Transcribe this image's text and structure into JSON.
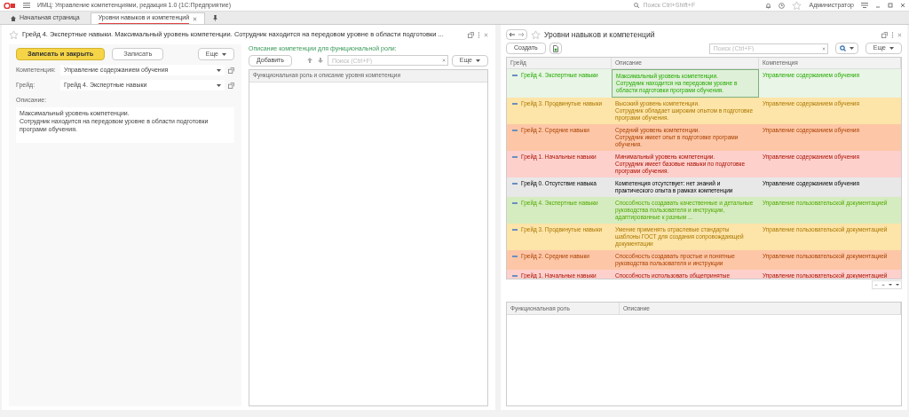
{
  "app_bar": {
    "title": "ИМЦ: Управление компетенциями, редакция 1.0  (1С:Предприятие)",
    "search": {
      "placeholder": "Поиск Ctrl+Shift+F"
    },
    "user": "Администратор"
  },
  "tabs": [
    {
      "label": "Начальная страница",
      "selected": false,
      "kind": "home"
    },
    {
      "label": "Уровни навыков и компетенций",
      "selected": true,
      "kind": "page"
    }
  ],
  "form": {
    "title": "Грейд 4. Экспертные навыки. Максимальный уровень компетенции. Сотрудник находится на передовом уровне в области подготовки ...",
    "buttons": [
      {
        "label": "Записать и закрыть",
        "kind": "primary"
      },
      {
        "label": "Записать",
        "kind": "plain"
      }
    ],
    "more": "Еще",
    "fields": [
      {
        "label": "Компетенция:",
        "value": "Управление содержанием обучения"
      },
      {
        "label": "Грейд:",
        "value": "Грейд 4. Экспертные навыки"
      }
    ],
    "description": {
      "label": "Описание:",
      "value": "Максимальный уровень компетенции.\nСотрудник находится на передовом уровне в области подготовки програми обучения."
    },
    "roles": {
      "title": "Описание компетенции для функциональной роли:",
      "add": "Добавить",
      "search": {
        "placeholder": "Поиск (Ctrl+F)"
      },
      "more": "Еще",
      "column": "Функциональная роль и описание уровня компетенции"
    }
  },
  "list": {
    "title": "Уровни навыков и компетенций",
    "create": "Создать",
    "search": {
      "placeholder": "Поиск (Ctrl+F)"
    },
    "more": "Еще",
    "columns": [
      "Грейд",
      "Описание",
      "Компетенция"
    ],
    "rows": [
      {
        "grade": "Грейд 4. Экспертные навыки",
        "description": "Максимальный уровень компетенции.\nСотрудник находится на передовом уровне в области подготовки програми обучения.",
        "competence": "Управление содержанием обучения",
        "color": "#e9f5e6",
        "selected": true
      },
      {
        "grade": "Грейд 3. Продвинутые навыки",
        "description": "Высокий уровень компетенции.\nСотрудник обладает широким опытом в подготовке програми обучения.",
        "competence": "Управление содержанием обучения",
        "color": "#fde4a8",
        "selected": false
      },
      {
        "grade": "Грейд 2. Средние навыки",
        "description": "Средний уровень компетенции.\nСотрудник имеет опыт в подготовке програми обучения.",
        "competence": "Управление содержанием обучения",
        "color": "#fdc7a7",
        "selected": false
      },
      {
        "grade": "Грейд 1. Начальные навыки",
        "description": "Минимальный уровень компетенции.\nСотрудник имеет базовые навыки по подготовке програми обучения.",
        "competence": "Управление содержанием обучения",
        "color": "#fdd0cc",
        "selected": false
      },
      {
        "grade": "Грейд 0. Отсутствие навыка",
        "description": "Компетенция отсутствует: нет знаний и практического опыта в рамках компетенции",
        "competence": "Управление содержанием обучения",
        "color": "#e8e8e8",
        "selected": false
      },
      {
        "grade": "Грейд 4. Экспертные навыки",
        "description": "Способность создавать качественные и детальные руководства пользователя и инструкции, адаптированные к разным ...",
        "competence": "Управление пользовательской документацией",
        "color": "#d5ecc0",
        "selected": false
      },
      {
        "grade": "Грейд 3. Продвинутые навыки",
        "description": "Умение применять отраслевые стандарты шаблоны ГОСТ для создания сопровождающей документации",
        "competence": "Управление пользовательской документацией",
        "color": "#fde4a8",
        "selected": false
      },
      {
        "grade": "Грейд 2. Средние навыки",
        "description": "Способность создавать простые и понятные руководства пользователя и инструкции",
        "competence": "Управление пользовательской документацией",
        "color": "#fdc7a7",
        "selected": false
      },
      {
        "grade": "Грейд 1. Начальные навыки",
        "description": "Способность использовать общепринятые",
        "competence": "Управление пользовательской документацией",
        "color": "#fdd0cc",
        "selected": false
      }
    ],
    "bottom_columns": [
      "Функциональная роль",
      "Описание"
    ]
  }
}
